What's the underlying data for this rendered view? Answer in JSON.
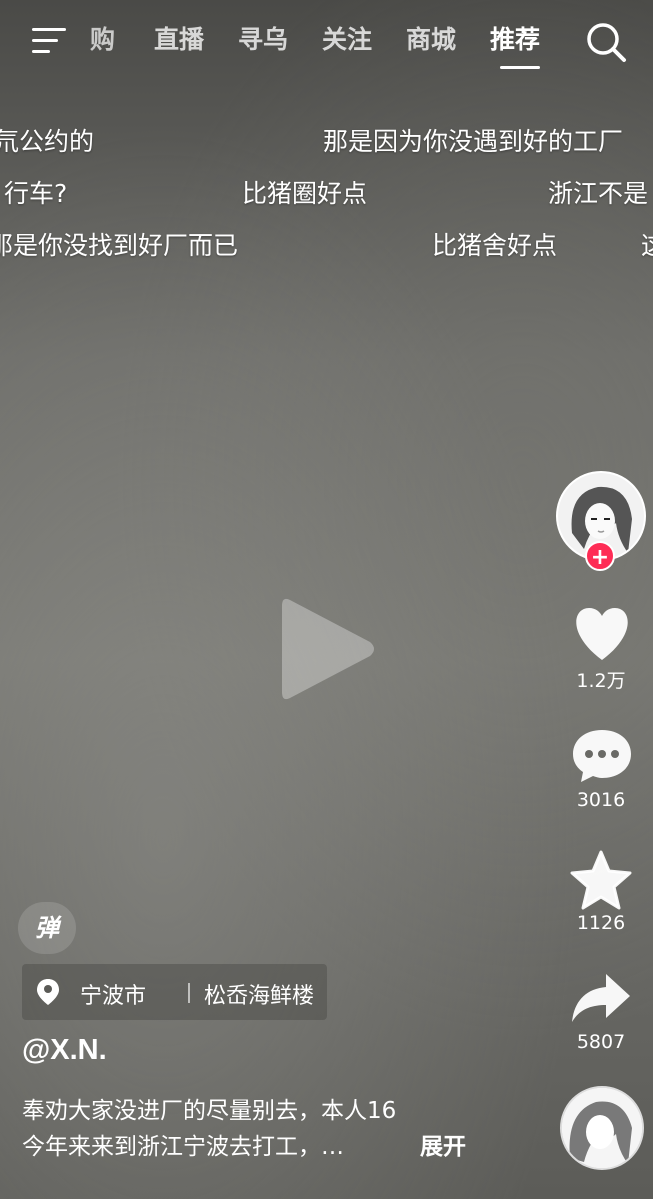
{
  "nav": {
    "tabs": [
      "购",
      "直播",
      "寻乌",
      "关注",
      "商城",
      "推荐"
    ],
    "active_tab": "推荐"
  },
  "danmaku": [
    "氘公约的",
    "那是因为你没遇到好的工厂",
    "行车?",
    "比猪圈好点",
    "浙江不是",
    "那是你没找到好厂而已",
    "比猪舍好点",
    "这"
  ],
  "actions": {
    "like_count": "1.2万",
    "comment_count": "3016",
    "favorite_count": "1126",
    "share_count": "5807",
    "follow_symbol": "+"
  },
  "danmaku_toggle": "弹",
  "location": {
    "city": "宁波市",
    "place": "松岙海鲜楼"
  },
  "post": {
    "username": "@X.N.",
    "desc_line1": "奉劝大家没进厂的尽量别去，本人16",
    "desc_line2": "今年来来到浙江宁波去打工，…",
    "expand_label": "展开"
  },
  "colors": {
    "follow_accent": "#fe2c55",
    "text": "#ffffff"
  },
  "icons": [
    "menu-icon",
    "search-icon",
    "play-icon",
    "heart-icon",
    "comment-icon",
    "star-icon",
    "share-icon",
    "location-pin-icon"
  ]
}
